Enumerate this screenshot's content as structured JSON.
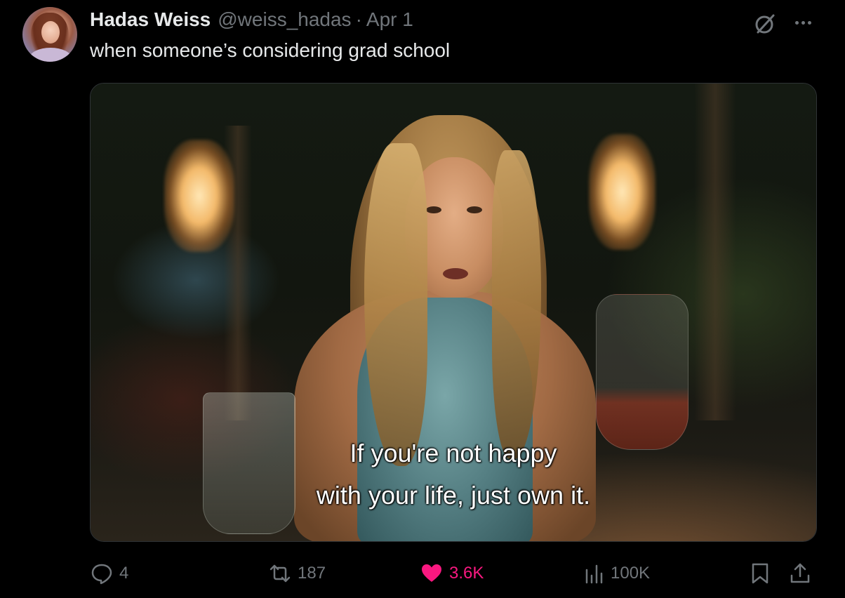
{
  "author": {
    "display_name": "Hadas Weiss",
    "handle": "@weiss_hadas",
    "separator": "·",
    "date": "Apr 1"
  },
  "tweet": {
    "text": "when someone’s considering grad school"
  },
  "media": {
    "subtitle_line1": "If you're not happy",
    "subtitle_line2": "with your life, just own it."
  },
  "actions": {
    "replies": "4",
    "reposts": "187",
    "likes": "3.6K",
    "views": "100K"
  },
  "icons": {
    "grok": "grok-icon",
    "more": "more-icon",
    "reply": "reply-icon",
    "repost": "repost-icon",
    "like": "heart-filled-icon",
    "views": "views-chart-icon",
    "bookmark": "bookmark-icon",
    "share": "share-icon"
  },
  "colors": {
    "background": "#000000",
    "text_primary": "#e7e9ea",
    "text_secondary": "#71767b",
    "like_active": "#f91880"
  }
}
